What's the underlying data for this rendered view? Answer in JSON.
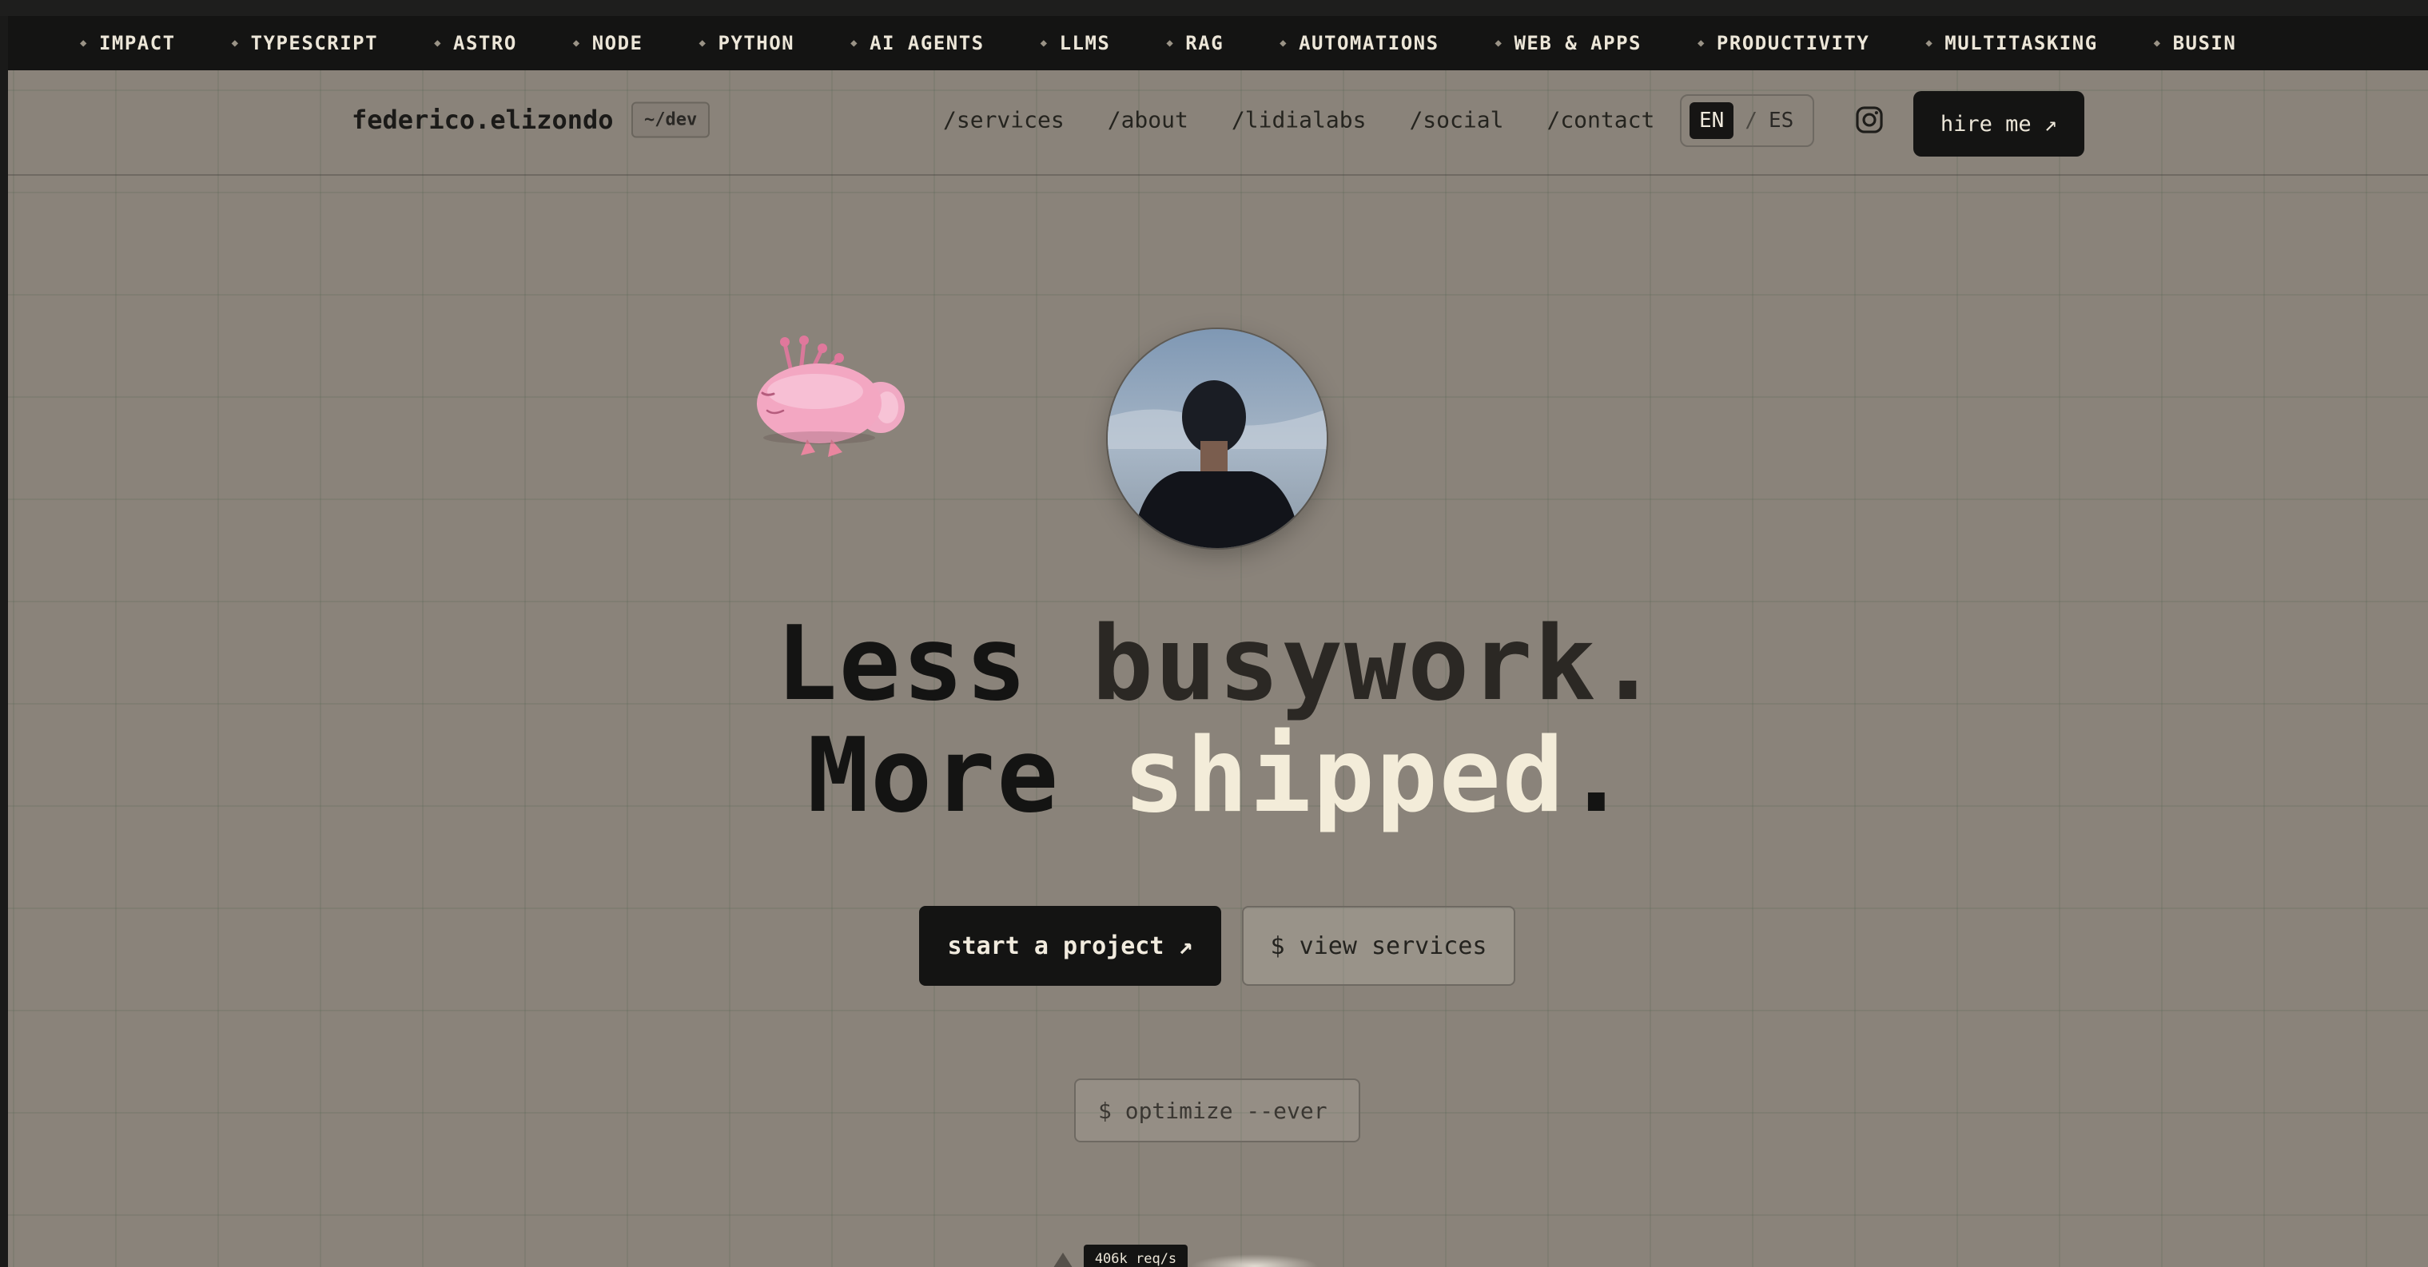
{
  "ticker": {
    "items": [
      "IMPACT",
      "TYPESCRIPT",
      "ASTRO",
      "NODE",
      "PYTHON",
      "AI AGENTS",
      "LLMS",
      "RAG",
      "AUTOMATIONS",
      "WEB & APPS",
      "PRODUCTIVITY",
      "MULTITASKING",
      "BUSIN"
    ]
  },
  "header": {
    "logo": "federico.elizondo",
    "badge": "~/dev",
    "nav": [
      "/services",
      "/about",
      "/lidialabs",
      "/social",
      "/contact"
    ],
    "lang": {
      "active": "EN",
      "separator": "/",
      "other": "ES"
    },
    "social_icon": "instagram-icon",
    "hire_label": "hire me ↗"
  },
  "hero": {
    "line1_word1": "Less",
    "line1_word2": "busywork.",
    "line2_word1": "More",
    "line2_word2": "shipped",
    "line2_end": ".",
    "cta_primary": "start a project ↗",
    "cta_secondary": "$ view services",
    "terminal": "$ optimize --ever",
    "metric": "406k req/s"
  },
  "colors": {
    "page_bg": "#8a837a",
    "ticker_bg": "#141413",
    "accent_cream": "#f3ecd9",
    "dark": "#141413"
  }
}
